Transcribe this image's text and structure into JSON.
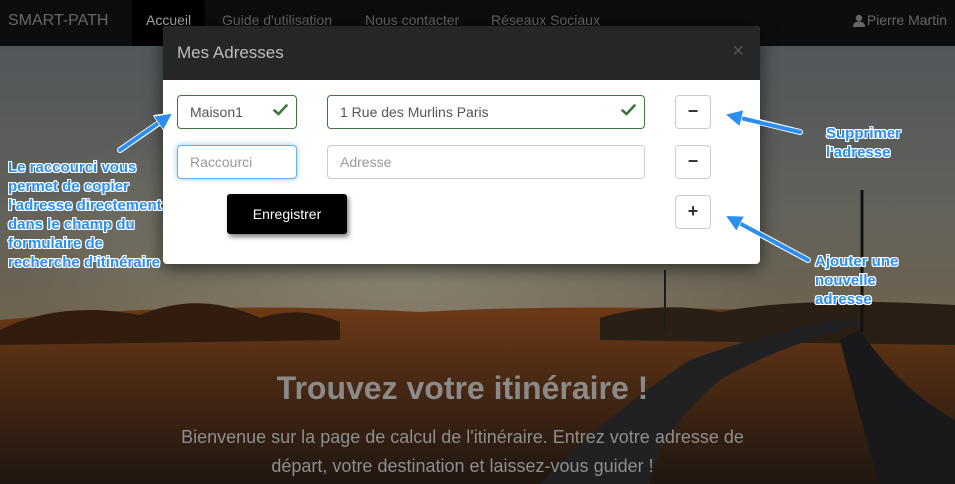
{
  "navbar": {
    "brand": "SMART-PATH",
    "items": [
      {
        "label": "Accueil",
        "active": true
      },
      {
        "label": "Guide d'utilisation"
      },
      {
        "label": "Nous contacter"
      },
      {
        "label": "Réseaux Sociaux"
      }
    ],
    "user": "Pierre Martin",
    "user_icon": "user-icon"
  },
  "hero": {
    "title": "Trouvez votre itinéraire !",
    "subtitle_line1": "Bienvenue sur la page de calcul de l'itinéraire. Entrez votre adresse de",
    "subtitle_line2": "départ, votre destination et laissez-vous guider !"
  },
  "modal": {
    "title": "Mes Adresses",
    "close_icon": "close-icon",
    "rows": [
      {
        "shortcut_value": "Maison1",
        "address_value": "1 Rue des Murlins Paris",
        "valid": true,
        "button": "−"
      },
      {
        "shortcut_placeholder": "Raccourci",
        "address_placeholder": "Adresse",
        "button": "−"
      }
    ],
    "add_button": "+",
    "save_label": "Enregistrer"
  },
  "annotations": {
    "left": [
      "Le raccourci vous",
      "permet de copier",
      "l'adresse directement",
      "dans le champ du",
      "formulaire de",
      "recherche d'itinéraire"
    ],
    "delete": [
      "Supprimer",
      "l'adresse"
    ],
    "add": [
      "Ajouter une",
      "nouvelle",
      "adresse"
    ]
  },
  "colors": {
    "annotation": "#2b8ef0",
    "valid": "#3c763d",
    "focus": "#66afe9",
    "navbar": "#151515"
  }
}
